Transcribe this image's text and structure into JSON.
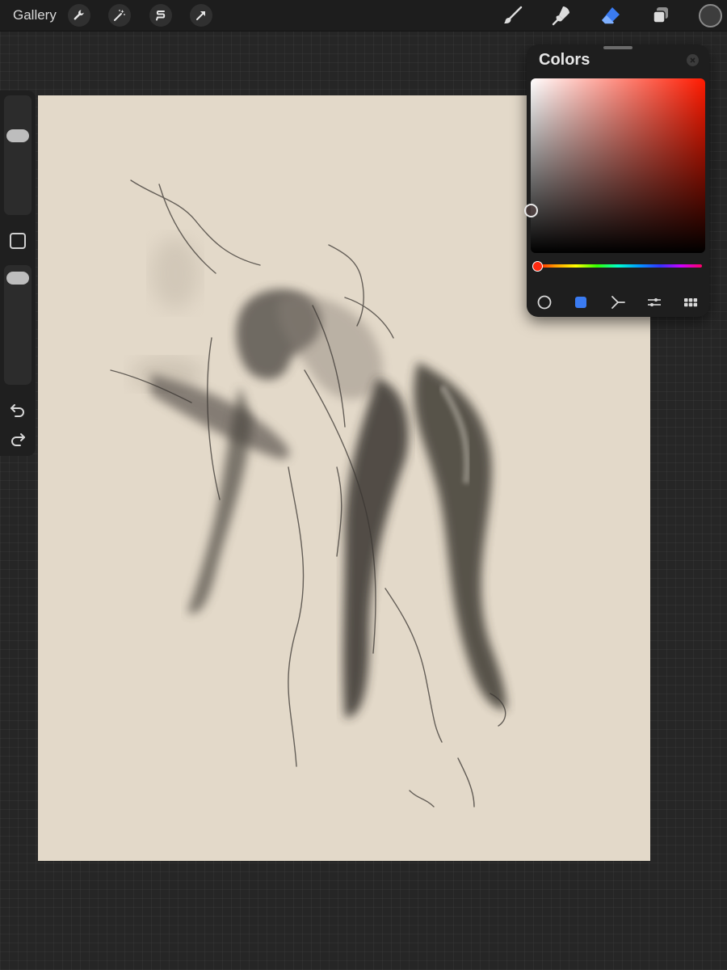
{
  "topbar": {
    "gallery_label": "Gallery",
    "actions": [
      {
        "name": "wrench-icon"
      },
      {
        "name": "magic-wand-icon"
      },
      {
        "name": "selection-icon"
      },
      {
        "name": "transform-arrow-icon"
      }
    ],
    "tools": [
      {
        "name": "brush-icon",
        "active": false
      },
      {
        "name": "smudge-icon",
        "active": false
      },
      {
        "name": "eraser-icon",
        "active": true
      },
      {
        "name": "layers-icon",
        "active": false
      }
    ],
    "current_color": "#3d3d3d",
    "active_tool_color": "#3a7bf2"
  },
  "sidebar": {
    "brush_size_level": 0.9,
    "opacity_level": 0.9,
    "modify_button": "square-icon",
    "undo": "undo-icon",
    "redo": "redo-icon"
  },
  "canvas": {
    "paper_color": "#e3d9c9",
    "artwork": "figure-sketch"
  },
  "colors_panel": {
    "title": "Colors",
    "hue_color": "#ff1a00",
    "hue_position": 0.0,
    "modes": [
      {
        "name": "disc-mode-icon",
        "active": false
      },
      {
        "name": "classic-mode-icon",
        "active": true
      },
      {
        "name": "harmony-mode-icon",
        "active": false
      },
      {
        "name": "value-mode-icon",
        "active": false
      },
      {
        "name": "palettes-mode-icon",
        "active": false
      }
    ]
  }
}
